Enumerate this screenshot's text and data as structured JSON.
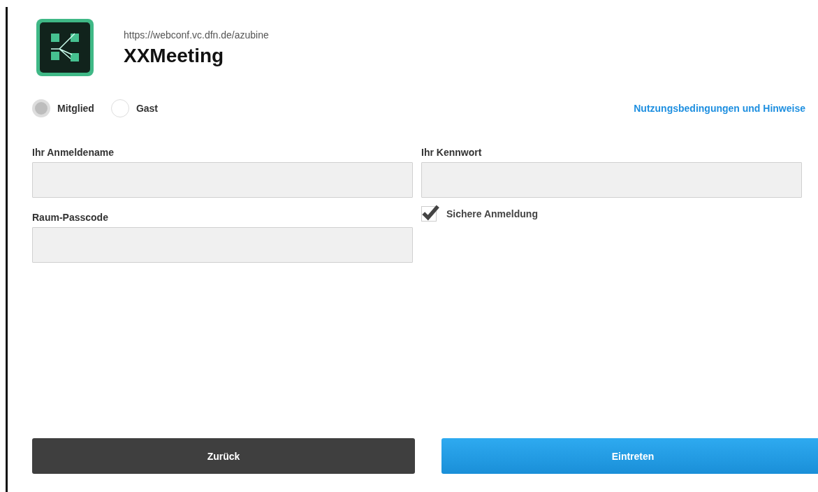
{
  "header": {
    "url": "https://webconf.vc.dfn.de/azubine",
    "title": "XXMeeting"
  },
  "login_type": [
    {
      "label": "Mitglied",
      "selected": true
    },
    {
      "label": "Gast",
      "selected": false
    }
  ],
  "terms_link": "Nutzungsbedingungen und Hinweise",
  "fields": {
    "username": {
      "label": "Ihr Anmeldename"
    },
    "password": {
      "label": "Ihr Kennwort"
    },
    "passcode": {
      "label": "Raum-Passcode"
    }
  },
  "secure_login": {
    "label": "Sichere Anmeldung",
    "checked": true
  },
  "buttons": [
    {
      "label": "Zurück",
      "kind": "secondary"
    },
    {
      "label": "Eintreten",
      "kind": "primary"
    }
  ]
}
